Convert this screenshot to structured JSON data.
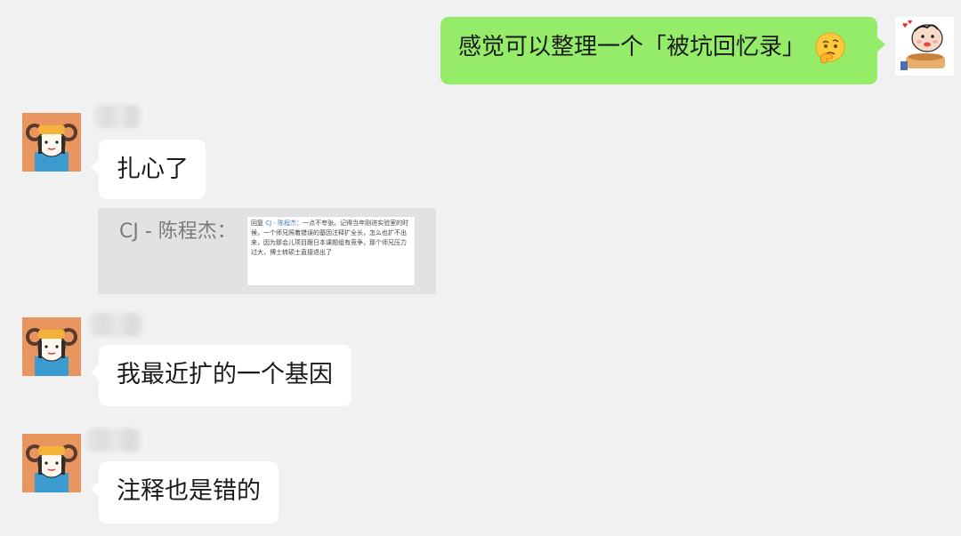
{
  "messages": [
    {
      "side": "right",
      "text": "感觉可以整理一个「被坑回忆录」",
      "emoji": "thinking-face-emoji"
    },
    {
      "side": "left",
      "text": "扎心了"
    },
    {
      "side": "left",
      "text": "我最近扩的一个基因"
    },
    {
      "side": "left",
      "text": "注释也是错的"
    }
  ],
  "quote": {
    "author": "CJ - 陈程杰：",
    "thumb_prefix": "回复 ",
    "thumb_name": "CJ - 陈程杰",
    "thumb_text": "：一点不夸张。记得当年刚进实验室的时候，一个师兄照着错误的基因注释扩全长，怎么也扩不出来，因为那会儿项目跟日本课题组有竞争，那个师兄压力过大，博士转硕士直接退出了"
  },
  "colors": {
    "background": "#f1f1f1",
    "my_bubble": "#95ec69",
    "other_bubble": "#ffffff",
    "quote_bg": "#e2e2e2"
  }
}
